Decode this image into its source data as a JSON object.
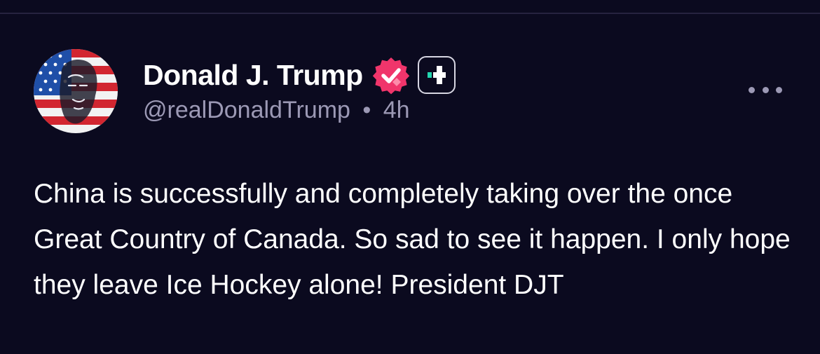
{
  "post": {
    "author": {
      "display_name": "Donald J. Trump",
      "handle": "@realDonaldTrump",
      "avatar_icon": "flag-portrait-avatar",
      "verified_icon": "verified-check-badge",
      "verified_color": "#f0356b",
      "plus_icon": "plus-badge-icon",
      "plus_accent": "#23d6b0"
    },
    "separator": "•",
    "time_ago": "4h",
    "more_icon": "more-dots-icon",
    "text": "China is successfully and completely taking over the once Great Country of Canada. So sad to see it happen. I only hope they leave Ice Hockey alone! President DJT"
  },
  "theme": {
    "background": "#0b0a1f",
    "muted_text": "#9c99b5",
    "divider": "#26233f"
  }
}
